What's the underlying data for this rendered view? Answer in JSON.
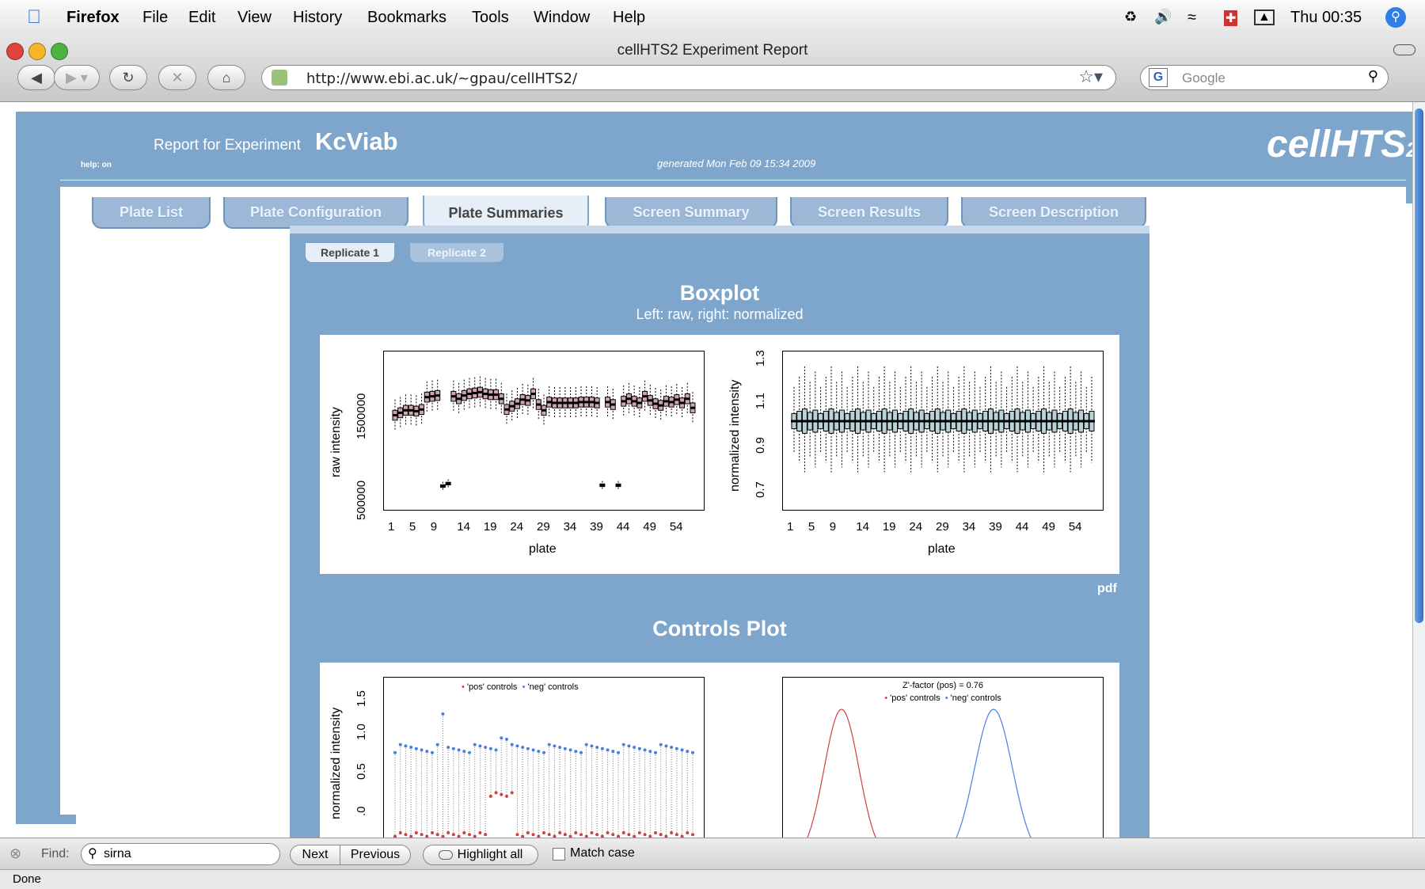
{
  "menubar": {
    "items": [
      "Firefox",
      "File",
      "Edit",
      "View",
      "History",
      "Bookmarks",
      "Tools",
      "Window",
      "Help"
    ],
    "clock": "Thu 00:35"
  },
  "window": {
    "title": "cellHTS2 Experiment Report"
  },
  "toolbar": {
    "url": "http://www.ebi.ac.uk/~gpau/cellHTS2/",
    "search_placeholder": "Google"
  },
  "report": {
    "prefix": "Report for Experiment",
    "experiment": "KcViab",
    "help": "help: on",
    "generated": "generated Mon Feb 09 15:34 2009",
    "logo_main": "cellHTS",
    "logo_sub": "2"
  },
  "tabs": [
    {
      "label": "Plate List",
      "active": false
    },
    {
      "label": "Plate Configuration",
      "active": false
    },
    {
      "label": "Plate Summaries",
      "active": true
    },
    {
      "label": "Screen Summary",
      "active": false
    },
    {
      "label": "Screen Results",
      "active": false
    },
    {
      "label": "Screen Description",
      "active": false
    }
  ],
  "subtabs": [
    {
      "label": "Replicate 1",
      "active": true
    },
    {
      "label": "Replicate 2",
      "active": false
    }
  ],
  "boxplot": {
    "title": "Boxplot",
    "subtitle": "Left: raw, right: normalized",
    "pdf_link": "pdf"
  },
  "controls": {
    "title": "Controls Plot"
  },
  "chart_data": [
    {
      "type": "box",
      "xlabel": "plate",
      "ylabel": "raw intensity",
      "xticks": [
        "1",
        "5",
        "9",
        "14",
        "19",
        "24",
        "29",
        "34",
        "39",
        "44",
        "49",
        "54"
      ],
      "yticks": [
        "500000",
        "1500000"
      ],
      "n_plates": 57,
      "medians": [
        1360000,
        1390000,
        1420000,
        1420000,
        1410000,
        1430000,
        1580000,
        1590000,
        1600000,
        500000,
        530000,
        1590000,
        1560000,
        1600000,
        1620000,
        1630000,
        1640000,
        1620000,
        1610000,
        1610000,
        1560000,
        1430000,
        1470000,
        1500000,
        1550000,
        1540000,
        1620000,
        1490000,
        1420000,
        1520000,
        1510000,
        1510000,
        1510000,
        1510000,
        1510000,
        1520000,
        1520000,
        1520000,
        1510000,
        510000,
        1520000,
        1490000,
        510000,
        1530000,
        1560000,
        1530000,
        1510000,
        1590000,
        1540000,
        1500000,
        1480000,
        1530000,
        1520000,
        1550000,
        1510000,
        1560000,
        1450000
      ]
    },
    {
      "type": "box",
      "xlabel": "plate",
      "ylabel": "normalized intensity",
      "xticks": [
        "1",
        "5",
        "9",
        "14",
        "19",
        "24",
        "29",
        "34",
        "39",
        "44",
        "49",
        "54"
      ],
      "yticks": [
        "0.7",
        "0.9",
        "1.1",
        "1.3"
      ],
      "n_plates": 57,
      "median": 1.0
    },
    {
      "type": "scatter",
      "ylabel": "normalized intensity",
      "yticks": [
        ".0",
        "0.5",
        "1.0",
        "1.5"
      ],
      "legend": [
        "'pos' controls",
        "'neg' controls"
      ],
      "colors": {
        "pos": "#d04040",
        "neg": "#4a7fe0"
      }
    },
    {
      "type": "line",
      "annotation": "Z'-factor (pos) = 0.76",
      "legend": [
        "'pos' controls",
        "'neg' controls"
      ],
      "colors": {
        "pos": "#d04040",
        "neg": "#4a7fe0"
      }
    }
  ],
  "findbar": {
    "label": "Find:",
    "query": "sirna",
    "next": "Next",
    "previous": "Previous",
    "highlight": "Highlight all",
    "match_case": "Match case"
  },
  "status": {
    "text": "Done"
  }
}
